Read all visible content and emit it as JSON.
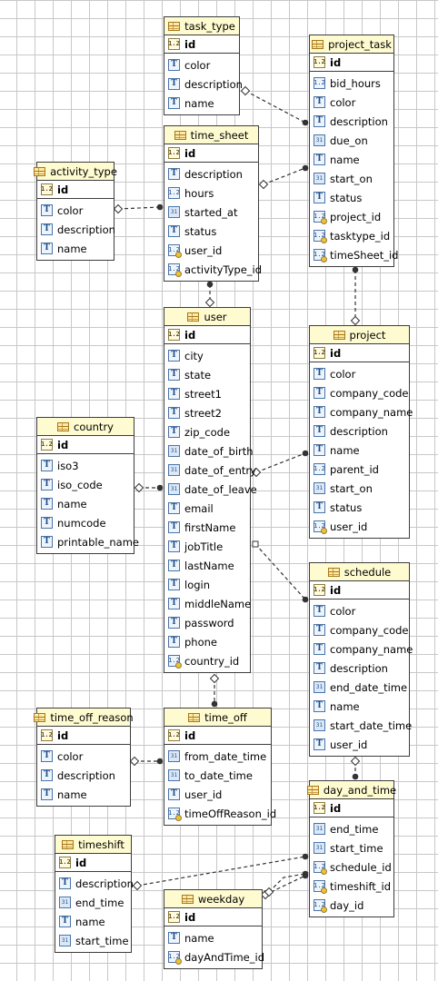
{
  "entities": {
    "task_type": {
      "name": "task_type",
      "pk": "id",
      "attributes": [
        {
          "icon": "text-icon",
          "label": "color"
        },
        {
          "icon": "text-icon",
          "label": "description"
        },
        {
          "icon": "text-icon",
          "label": "name"
        }
      ]
    },
    "project_task": {
      "name": "project_task",
      "pk": "id",
      "attributes": [
        {
          "icon": "number-icon",
          "label": "bid_hours"
        },
        {
          "icon": "text-icon",
          "label": "color"
        },
        {
          "icon": "text-icon",
          "label": "description"
        },
        {
          "icon": "date-icon",
          "label": "due_on"
        },
        {
          "icon": "text-icon",
          "label": "name"
        },
        {
          "icon": "date-icon",
          "label": "start_on"
        },
        {
          "icon": "text-icon",
          "label": "status"
        },
        {
          "icon": "fk-key-icon",
          "label": "project_id"
        },
        {
          "icon": "fk-key-icon",
          "label": "tasktype_id"
        },
        {
          "icon": "fk-key-icon",
          "label": "timeSheet_id"
        }
      ]
    },
    "time_sheet": {
      "name": "time_sheet",
      "pk": "id",
      "attributes": [
        {
          "icon": "text-icon",
          "label": "description"
        },
        {
          "icon": "number-icon",
          "label": "hours"
        },
        {
          "icon": "date-icon",
          "label": "started_at"
        },
        {
          "icon": "text-icon",
          "label": "status"
        },
        {
          "icon": "fk-key-icon",
          "label": "user_id"
        },
        {
          "icon": "fk-key-icon",
          "label": "activityType_id"
        }
      ]
    },
    "activity_type": {
      "name": "activity_type",
      "pk": "id",
      "attributes": [
        {
          "icon": "text-icon",
          "label": "color"
        },
        {
          "icon": "text-icon",
          "label": "description"
        },
        {
          "icon": "text-icon",
          "label": "name"
        }
      ]
    },
    "user": {
      "name": "user",
      "pk": "id",
      "attributes": [
        {
          "icon": "text-icon",
          "label": "city"
        },
        {
          "icon": "text-icon",
          "label": "state"
        },
        {
          "icon": "text-icon",
          "label": "street1"
        },
        {
          "icon": "text-icon",
          "label": "street2"
        },
        {
          "icon": "text-icon",
          "label": "zip_code"
        },
        {
          "icon": "date-icon",
          "label": "date_of_birth"
        },
        {
          "icon": "date-icon",
          "label": "date_of_entry"
        },
        {
          "icon": "date-icon",
          "label": "date_of_leave"
        },
        {
          "icon": "text-icon",
          "label": "email"
        },
        {
          "icon": "text-icon",
          "label": "firstName"
        },
        {
          "icon": "text-icon",
          "label": "jobTitle"
        },
        {
          "icon": "text-icon",
          "label": "lastName"
        },
        {
          "icon": "text-icon",
          "label": "login"
        },
        {
          "icon": "text-icon",
          "label": "middleName"
        },
        {
          "icon": "text-icon",
          "label": "password"
        },
        {
          "icon": "text-icon",
          "label": "phone"
        },
        {
          "icon": "fk-key-icon",
          "label": "country_id"
        }
      ]
    },
    "project": {
      "name": "project",
      "pk": "id",
      "attributes": [
        {
          "icon": "text-icon",
          "label": "color"
        },
        {
          "icon": "text-icon",
          "label": "company_code"
        },
        {
          "icon": "text-icon",
          "label": "company_name"
        },
        {
          "icon": "text-icon",
          "label": "description"
        },
        {
          "icon": "text-icon",
          "label": "name"
        },
        {
          "icon": "number-icon",
          "label": "parent_id"
        },
        {
          "icon": "date-icon",
          "label": "start_on"
        },
        {
          "icon": "text-icon",
          "label": "status"
        },
        {
          "icon": "fk-key-icon",
          "label": "user_id"
        }
      ]
    },
    "country": {
      "name": "country",
      "pk": "id",
      "attributes": [
        {
          "icon": "text-icon",
          "label": "iso3"
        },
        {
          "icon": "text-icon",
          "label": "iso_code"
        },
        {
          "icon": "text-icon",
          "label": "name"
        },
        {
          "icon": "text-icon",
          "label": "numcode"
        },
        {
          "icon": "text-icon",
          "label": "printable_name"
        }
      ]
    },
    "schedule": {
      "name": "schedule",
      "pk": "id",
      "attributes": [
        {
          "icon": "text-icon",
          "label": "color"
        },
        {
          "icon": "text-icon",
          "label": "company_code"
        },
        {
          "icon": "text-icon",
          "label": "company_name"
        },
        {
          "icon": "text-icon",
          "label": "description"
        },
        {
          "icon": "date-icon",
          "label": "end_date_time"
        },
        {
          "icon": "text-icon",
          "label": "name"
        },
        {
          "icon": "date-icon",
          "label": "start_date_time"
        },
        {
          "icon": "text-icon",
          "label": "user_id"
        }
      ]
    },
    "time_off_reason": {
      "name": "time_off_reason",
      "pk": "id",
      "attributes": [
        {
          "icon": "text-icon",
          "label": "color"
        },
        {
          "icon": "text-icon",
          "label": "description"
        },
        {
          "icon": "text-icon",
          "label": "name"
        }
      ]
    },
    "time_off": {
      "name": "time_off",
      "pk": "id",
      "attributes": [
        {
          "icon": "date-icon",
          "label": "from_date_time"
        },
        {
          "icon": "date-icon",
          "label": "to_date_time"
        },
        {
          "icon": "text-icon",
          "label": "user_id"
        },
        {
          "icon": "fk-key-icon",
          "label": "timeOffReason_id"
        }
      ]
    },
    "day_and_time": {
      "name": "day_and_time",
      "pk": "id",
      "attributes": [
        {
          "icon": "date-icon",
          "label": "end_time"
        },
        {
          "icon": "date-icon",
          "label": "start_time"
        },
        {
          "icon": "fk-key-icon",
          "label": "schedule_id"
        },
        {
          "icon": "fk-key-icon",
          "label": "timeshift_id"
        },
        {
          "icon": "fk-key-icon",
          "label": "day_id"
        }
      ]
    },
    "timeshift": {
      "name": "timeshift",
      "pk": "id",
      "attributes": [
        {
          "icon": "text-icon",
          "label": "description"
        },
        {
          "icon": "date-icon",
          "label": "end_time"
        },
        {
          "icon": "text-icon",
          "label": "name"
        },
        {
          "icon": "date-icon",
          "label": "start_time"
        }
      ]
    },
    "weekday": {
      "name": "weekday",
      "pk": "id",
      "attributes": [
        {
          "icon": "text-icon",
          "label": "name"
        },
        {
          "icon": "fk-key-icon",
          "label": "dayAndTime_id"
        }
      ]
    }
  },
  "colors": {
    "header": "#fffbd0",
    "border": "#3c3c3c",
    "grid": "#c8c8c8",
    "link": "#333333"
  }
}
